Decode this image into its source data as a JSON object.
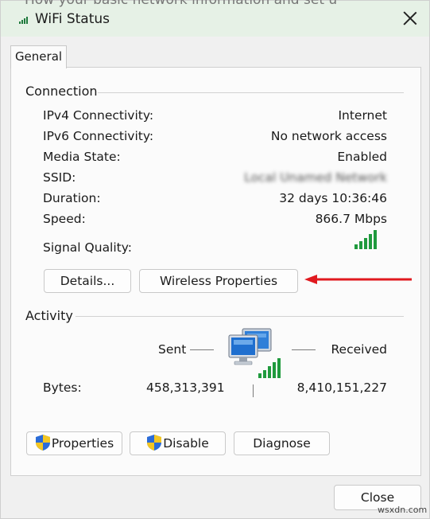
{
  "window": {
    "title": "WiFi Status",
    "background_text": "How your basic network information and set u"
  },
  "tabs": [
    {
      "label": "General"
    }
  ],
  "connection": {
    "title": "Connection",
    "rows": [
      {
        "label": "IPv4 Connectivity:",
        "value": "Internet"
      },
      {
        "label": "IPv6 Connectivity:",
        "value": "No network access"
      },
      {
        "label": "Media State:",
        "value": "Enabled"
      },
      {
        "label": "SSID:",
        "value": "Local Unamed Network"
      },
      {
        "label": "Duration:",
        "value": "32 days 10:36:46"
      },
      {
        "label": "Speed:",
        "value": "866.7 Mbps"
      }
    ],
    "signal_quality_label": "Signal Quality:",
    "signal_bars": 5,
    "details_button": "Details...",
    "wireless_properties_button": "Wireless Properties"
  },
  "activity": {
    "title": "Activity",
    "sent_label": "Sent",
    "received_label": "Received",
    "bytes_label": "Bytes:",
    "bytes_sent": "458,313,391",
    "bytes_received": "8,410,151,227"
  },
  "buttons": {
    "properties": "Properties",
    "disable": "Disable",
    "diagnose": "Diagnose",
    "close": "Close"
  },
  "watermark": "wsxdn.com",
  "colors": {
    "titlebar": "#e6f1e6",
    "signal": "#1f9a3d",
    "arrow": "#e0191f",
    "shield_blue": "#2b6cd8",
    "shield_yellow": "#f3c623"
  }
}
